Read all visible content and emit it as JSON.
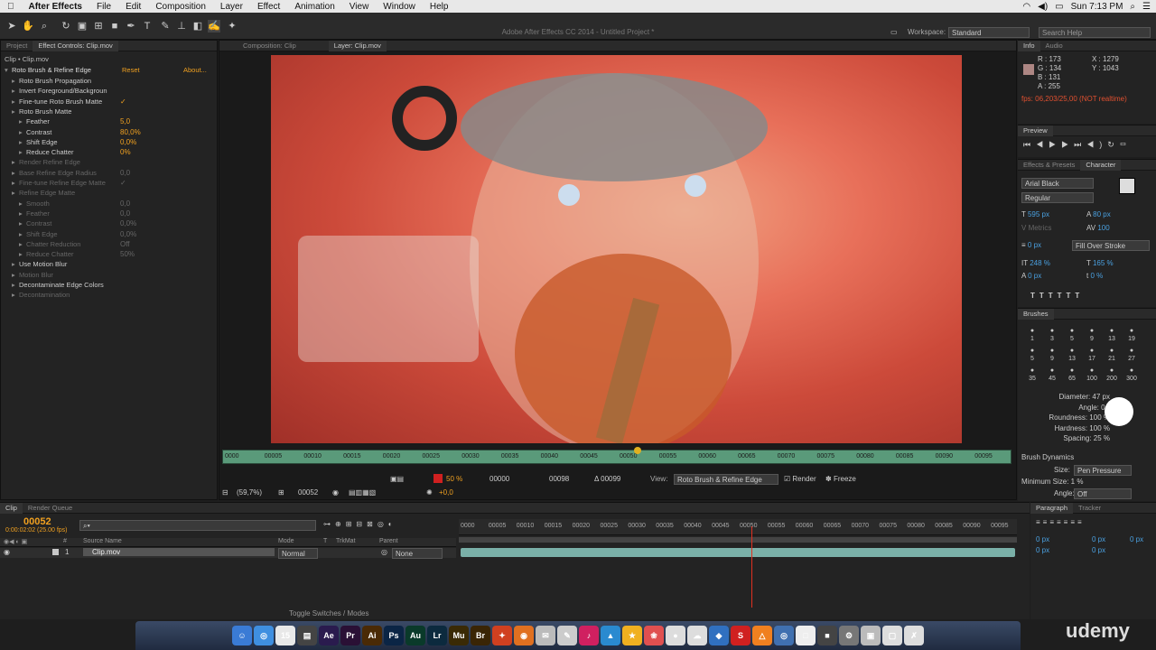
{
  "menubar": {
    "apple": "",
    "app_name": "After Effects",
    "items": [
      "File",
      "Edit",
      "Composition",
      "Layer",
      "Effect",
      "Animation",
      "View",
      "Window",
      "Help"
    ],
    "clock": "Sun 7:13 PM"
  },
  "toolbar": {
    "window_title": "Adobe After Effects CC 2014 - Untitled Project *",
    "workspace_label": "Workspace:",
    "workspace_value": "Standard",
    "search_placeholder": "Search Help"
  },
  "left_panel": {
    "tabs": [
      "Project",
      "Effect Controls: Clip.mov"
    ],
    "breadcrumb": "Clip • Clip.mov",
    "effect_name": "Roto Brush & Refine Edge",
    "reset": "Reset",
    "about": "About...",
    "rows": [
      {
        "label": "Roto Brush Propagation",
        "value": "",
        "dim": false,
        "indent": 1
      },
      {
        "label": "Invert Foreground/Backgroun",
        "value": "",
        "dim": false,
        "indent": 1
      },
      {
        "label": "Fine-tune Roto Brush Matte",
        "value": "✓",
        "dim": false,
        "indent": 1
      },
      {
        "label": "Roto Brush Matte",
        "value": "",
        "dim": false,
        "indent": 1
      },
      {
        "label": "Feather",
        "value": "5,0",
        "dim": false,
        "indent": 2
      },
      {
        "label": "Contrast",
        "value": "80,0%",
        "dim": false,
        "indent": 2
      },
      {
        "label": "Shift Edge",
        "value": "0,0%",
        "dim": false,
        "indent": 2
      },
      {
        "label": "Reduce Chatter",
        "value": "0%",
        "dim": false,
        "indent": 2
      },
      {
        "label": "Render Refine Edge",
        "value": "",
        "dim": true,
        "indent": 1
      },
      {
        "label": "Base Refine Edge Radius",
        "value": "0,0",
        "dim": true,
        "indent": 1
      },
      {
        "label": "Fine-tune Refine Edge Matte",
        "value": "✓",
        "dim": true,
        "indent": 1
      },
      {
        "label": "Refine Edge Matte",
        "value": "",
        "dim": true,
        "indent": 1
      },
      {
        "label": "Smooth",
        "value": "0,0",
        "dim": true,
        "indent": 2
      },
      {
        "label": "Feather",
        "value": "0,0",
        "dim": true,
        "indent": 2
      },
      {
        "label": "Contrast",
        "value": "0,0%",
        "dim": true,
        "indent": 2
      },
      {
        "label": "Shift Edge",
        "value": "0,0%",
        "dim": true,
        "indent": 2
      },
      {
        "label": "Chatter Reduction",
        "value": "Off",
        "dim": true,
        "indent": 2
      },
      {
        "label": "Reduce Chatter",
        "value": "50%",
        "dim": true,
        "indent": 2
      },
      {
        "label": "Use Motion Blur",
        "value": "",
        "dim": false,
        "indent": 1
      },
      {
        "label": "Motion Blur",
        "value": "",
        "dim": true,
        "indent": 1
      },
      {
        "label": "Decontaminate Edge Colors",
        "value": "",
        "dim": false,
        "indent": 1
      },
      {
        "label": "Decontamination",
        "value": "",
        "dim": true,
        "indent": 1
      }
    ]
  },
  "viewer": {
    "tabs": [
      "Composition: Clip",
      "Layer: Clip.mov"
    ],
    "ruler_ticks": [
      "0000",
      "00005",
      "00010",
      "00015",
      "00020",
      "00025",
      "00030",
      "00035",
      "00040",
      "00045",
      "00050",
      "00055",
      "00060",
      "00065",
      "00070",
      "00075",
      "00080",
      "00085",
      "00090",
      "00095"
    ],
    "zoom": "50 %",
    "in_frame": "00000",
    "out_frame": "00098",
    "duration": "Δ 00099",
    "view_label": "View:",
    "view_value": "Roto Brush & Refine Edge",
    "render_label": "Render",
    "freeze_label": "Freeze",
    "magnification": "(59,7%)",
    "current_frame": "00052",
    "exposure": "+0,0"
  },
  "info_panel": {
    "tabs": [
      "Info",
      "Audio"
    ],
    "r": "R : 173",
    "g": "G : 134",
    "b": "B : 131",
    "a": "A : 255",
    "x": "X : 1279",
    "y": "Y : 1043",
    "fps": "fps: 06,203/25,00 (NOT realtime)",
    "swatch": "#ad8683"
  },
  "preview_panel": {
    "title": "Preview"
  },
  "character_panel": {
    "tabs": [
      "Effects & Presets",
      "Character"
    ],
    "font": "Arial Black",
    "style": "Regular",
    "size": "595 px",
    "leading": "80 px",
    "kerning": "Metrics",
    "tracking": "100",
    "stroke_width": "0 px",
    "stroke_type": "Fill Over Stroke",
    "vscale": "248 %",
    "hscale": "165 %",
    "baseline": "0 px",
    "tsume": "0 %"
  },
  "brushes_panel": {
    "title": "Brushes",
    "sizes": [
      "1",
      "3",
      "5",
      "9",
      "13",
      "19",
      "5",
      "9",
      "13",
      "17",
      "21",
      "27",
      "35",
      "45",
      "65",
      "100",
      "200",
      "300"
    ],
    "diameter": "Diameter: 47 px",
    "angle": "Angle: 0 °",
    "roundness": "Roundness: 100 %",
    "hardness": "Hardness: 100 %",
    "spacing": "Spacing: 25 %",
    "dynamics": "Brush Dynamics",
    "size_label": "Size:",
    "size_value": "Pen Pressure",
    "min_size": "Minimum Size: 1 %",
    "angle_dyn_label": "Angle:",
    "angle_dyn_value": "Off"
  },
  "paragraph_panel": {
    "tabs": [
      "Paragraph",
      "Tracker"
    ],
    "indents": [
      "0 px",
      "0 px",
      "0 px",
      "0 px",
      "0 px"
    ]
  },
  "timeline": {
    "tabs": [
      "Clip",
      "Render Queue"
    ],
    "timecode": "00052",
    "timecode_sub": "0:00:02:02 (25.00 fps)",
    "search_placeholder": "⌕▾",
    "columns": [
      "#",
      "Source Name",
      "Mode",
      "T",
      "TrkMat",
      "Parent"
    ],
    "layer": {
      "num": "1",
      "name": "Clip.mov",
      "mode": "Normal",
      "parent": "None"
    },
    "ruler_ticks": [
      "0000",
      "00005",
      "00010",
      "00015",
      "00020",
      "00025",
      "00030",
      "00035",
      "00040",
      "00045",
      "00050",
      "00055",
      "00060",
      "00065",
      "00070",
      "00075",
      "00080",
      "00085",
      "00090",
      "00095"
    ],
    "toggle_label": "Toggle Switches / Modes"
  },
  "dock": {
    "apps": [
      "☺",
      "◎",
      "15",
      "▤",
      "Ae",
      "Pr",
      "Ai",
      "Ps",
      "Au",
      "Lr",
      "Mu",
      "Br",
      "✦",
      "◉",
      "✉",
      "✎",
      "♪",
      "▲",
      "★",
      "❀",
      "●",
      "☁",
      "◆",
      "S",
      "△",
      "◎",
      "□",
      "■",
      "⚙",
      "▣",
      "▢",
      "✗"
    ],
    "colors": [
      "#3a7bd5",
      "#3f8fe0",
      "#e8e8e8",
      "#444",
      "#2a1b4e",
      "#2a1035",
      "#4a2a05",
      "#0b2545",
      "#0a3a2a",
      "#0c2a3e",
      "#3a2a05",
      "#3a2505",
      "#d04020",
      "#e07020",
      "#bbb",
      "#ccc",
      "#d02060",
      "#2a8ad0",
      "#f0b020",
      "#e05050",
      "#ddd",
      "#ddd",
      "#3070c0",
      "#d02020",
      "#f08020",
      "#4070b0",
      "#eee",
      "#444",
      "#777",
      "#bbb",
      "#ddd",
      "#ddd"
    ],
    "watermark": "udemy"
  }
}
